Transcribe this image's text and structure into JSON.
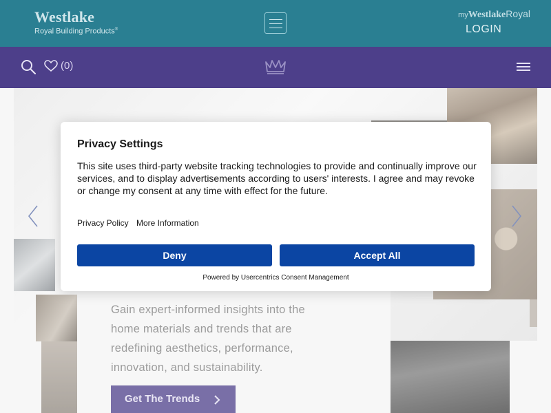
{
  "header": {
    "logo_line1": "Westlake",
    "logo_line2": "Royal Building Products",
    "logo_tm": "®",
    "my_prefix": "my",
    "my_brand": "Westlake",
    "my_suffix": "Royal",
    "login_label": "LOGIN"
  },
  "nav": {
    "favorites_count": "(0)",
    "icons": {
      "search": "search-icon",
      "favorites": "heart-icon",
      "home": "crown-icon",
      "menu": "hamburger-icon"
    }
  },
  "hero": {
    "description": "Gain expert-informed insights into the home materials and trends that are redefining aesthetics, performance, innovation, and sustainability.",
    "cta_label": "Get The Trends"
  },
  "privacy_modal": {
    "title": "Privacy Settings",
    "body": "This site uses third-party website tracking technologies to provide and continually improve our services, and to display advertisements according to users' interests. I agree and may revoke or change my consent at any time with effect for the future.",
    "privacy_policy_label": "Privacy Policy",
    "more_info_label": "More Information",
    "deny_label": "Deny",
    "accept_label": "Accept All",
    "powered_by": "Powered by Usercentrics Consent Management"
  },
  "colors": {
    "topbar": "#2a7f92",
    "navbar": "#4d3f8a",
    "modal_button": "#0b45a3"
  }
}
